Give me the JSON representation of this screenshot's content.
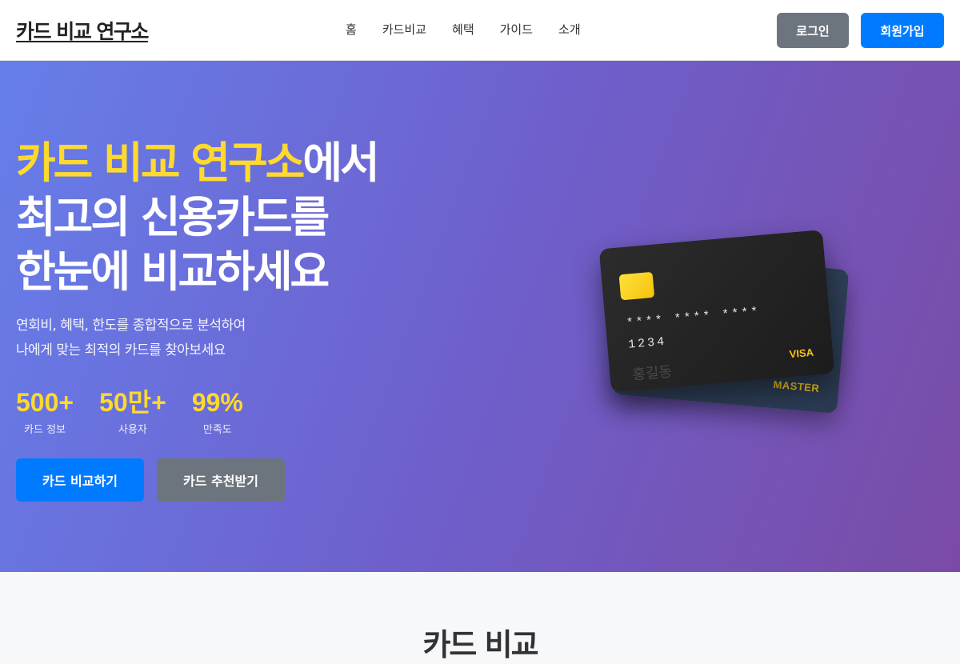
{
  "header": {
    "logo": "카드 비교 연구소",
    "nav": [
      "홈",
      "카드비교",
      "혜택",
      "가이드",
      "소개"
    ],
    "login_label": "로그인",
    "signup_label": "회원가입"
  },
  "hero": {
    "title_highlight": "카드 비교 연구소",
    "title_rest_line1": "에서",
    "title_line2": "최고의 신용카드를",
    "title_line3": "한눈에 비교하세요",
    "desc_line1": "연회비, 혜택, 한도를 종합적으로 분석하여",
    "desc_line2": "나에게 맞는 최적의 카드를 찾아보세요",
    "stats": [
      {
        "value": "500+",
        "label": "카드 정보"
      },
      {
        "value": "50만+",
        "label": "사용자"
      },
      {
        "value": "99%",
        "label": "만족도"
      }
    ],
    "compare_button": "카드 비교하기",
    "recommend_button": "카드 추천받기"
  },
  "cards": {
    "front": {
      "number": "**** **** **** 1234",
      "holder": "홍길동",
      "brand": "VISA"
    },
    "back": {
      "brand": "MASTER"
    }
  },
  "section": {
    "title": "카드 비교"
  },
  "colors": {
    "accent_yellow": "#ffd92e",
    "primary_blue": "#007bff",
    "secondary_gray": "#6c757d"
  }
}
